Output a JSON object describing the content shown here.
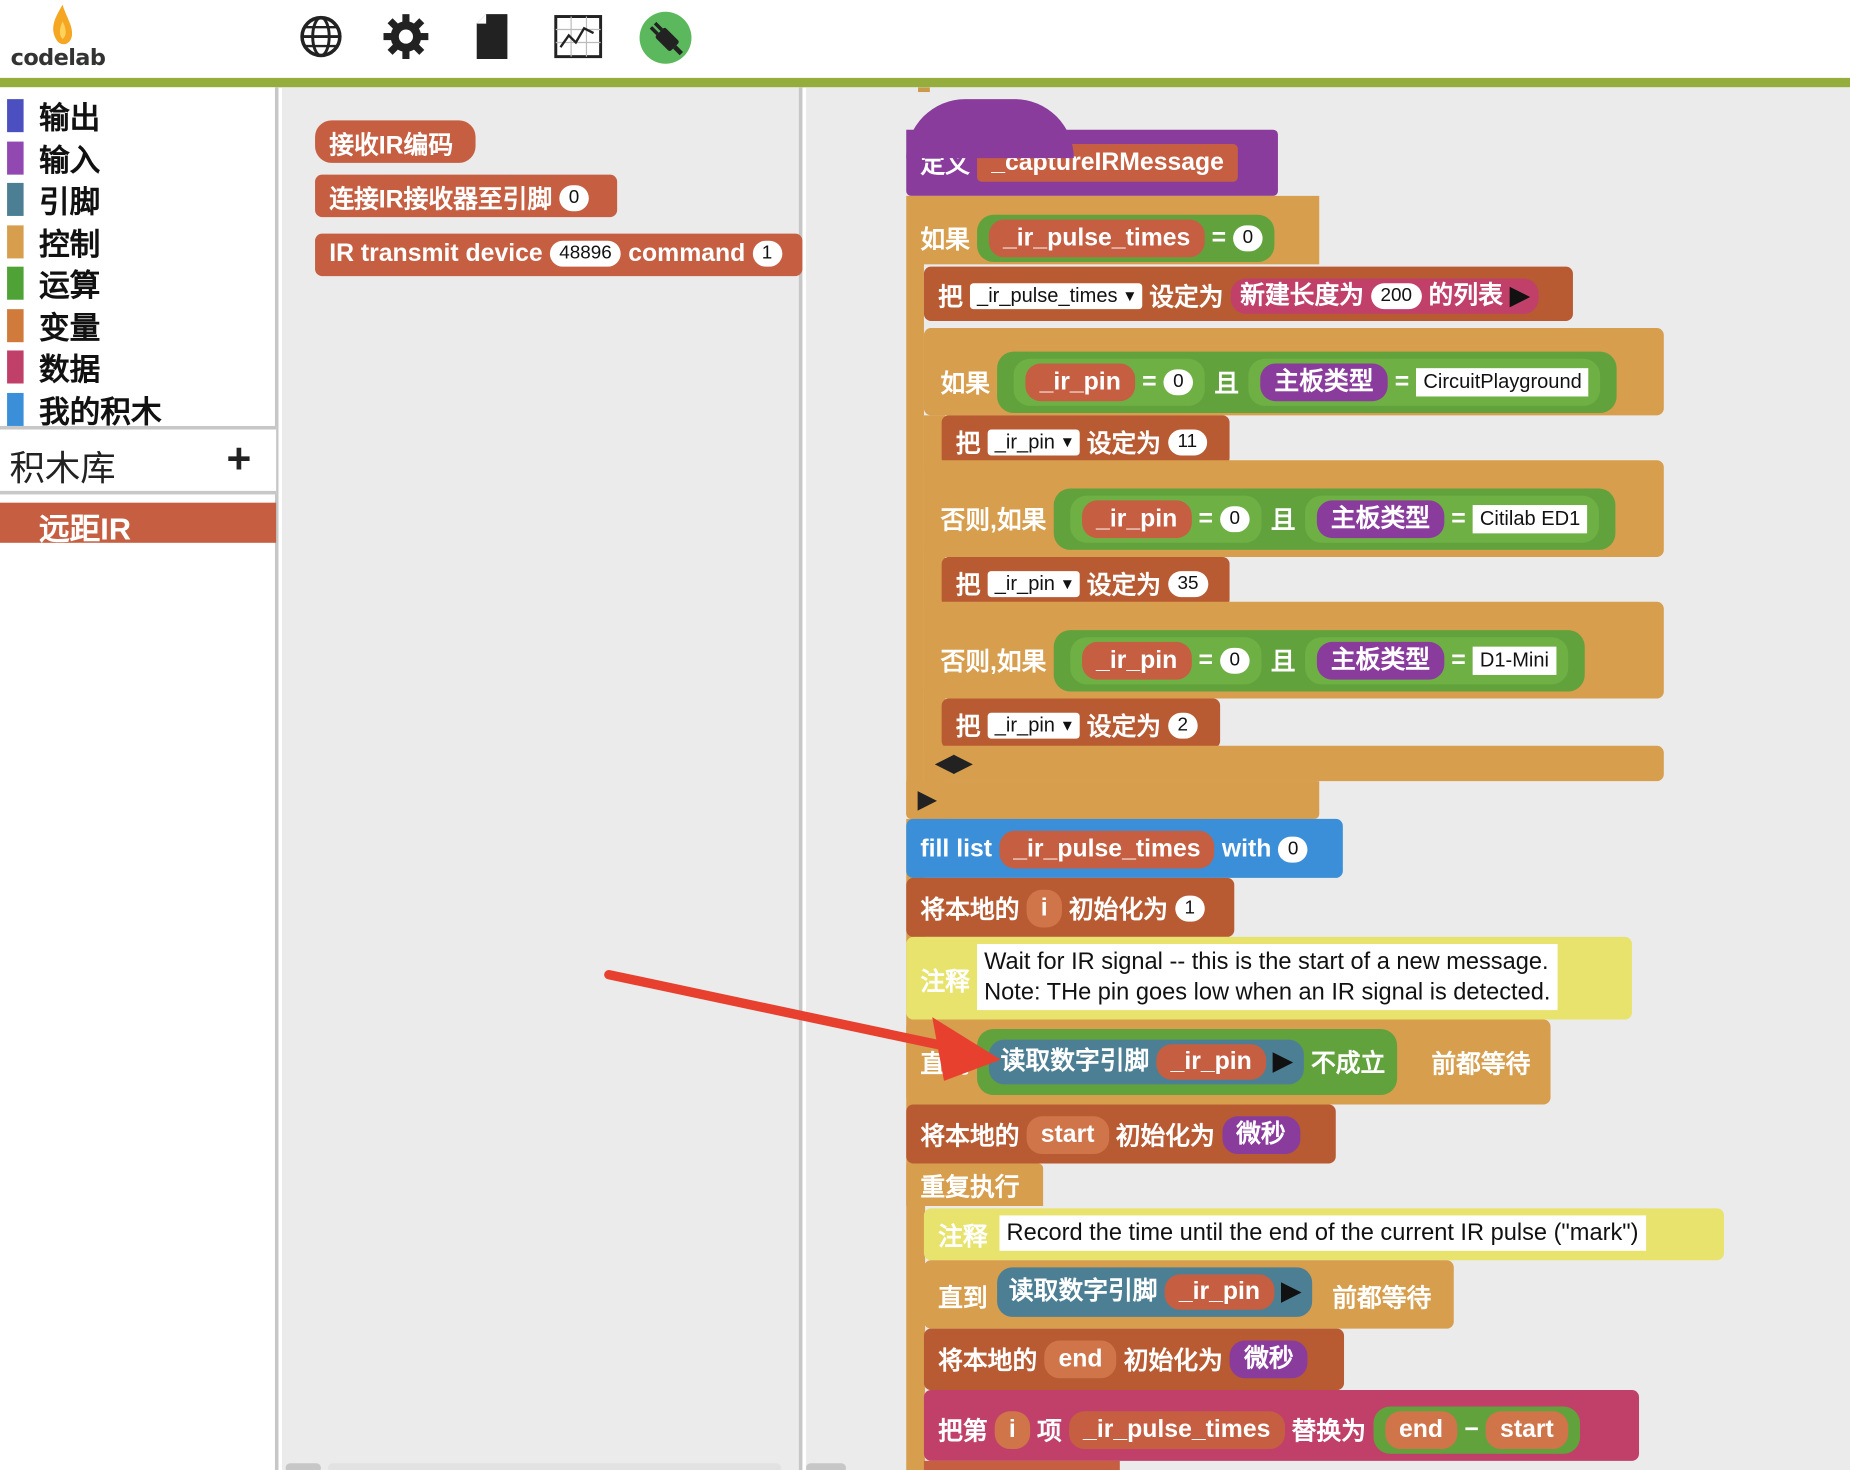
{
  "app": {
    "logo_text": "codelab"
  },
  "toolbar": {
    "icons": [
      "globe-icon",
      "gear-icon",
      "file-icon",
      "graph-icon",
      "usb-connection-icon"
    ]
  },
  "palette": {
    "categories": [
      {
        "label": "输出",
        "color": "#4b4fc0"
      },
      {
        "label": "输入",
        "color": "#9148b0"
      },
      {
        "label": "引脚",
        "color": "#4d7f94"
      },
      {
        "label": "控制",
        "color": "#d79e4d"
      },
      {
        "label": "运算",
        "color": "#4fa235"
      },
      {
        "label": "变量",
        "color": "#d07a3b"
      },
      {
        "label": "数据",
        "color": "#c0406a"
      },
      {
        "label": "我的积木",
        "color": "#3b8fd8"
      }
    ],
    "library_label": "积木库",
    "library_add": "+",
    "library_item": "远距IR"
  },
  "flyout": {
    "receive_ir": "接收IR编码",
    "attach_ir": {
      "text": "连接IR接收器至引脚",
      "pin": "0"
    },
    "ir_transmit": {
      "text1": "IR transmit device",
      "device": "48896",
      "text2": "command",
      "command": "1"
    }
  },
  "script": {
    "define": {
      "keyword": "定义",
      "name": "_captureIRMessage"
    },
    "if1": {
      "keyword": "如果",
      "var": "_ir_pulse_times",
      "op": "=",
      "value": "0"
    },
    "set_list": {
      "keyword": "把",
      "var": "_ir_pulse_times",
      "set_to": "设定为",
      "new_list": "新建长度为",
      "length": "200",
      "list_suffix": "的列表"
    },
    "if2": {
      "keyword": "如果",
      "var": "_ir_pin",
      "op": "=",
      "value": "0",
      "and": "且",
      "board_type": "主板类型",
      "board_value": "CircuitPlayground"
    },
    "set_pin_11": {
      "keyword": "把",
      "var": "_ir_pin",
      "set_to": "设定为",
      "value": "11"
    },
    "elseif1": {
      "keyword": "否则,如果",
      "var": "_ir_pin",
      "op": "=",
      "value": "0",
      "and": "且",
      "board_type": "主板类型",
      "board_value": "Citilab ED1"
    },
    "set_pin_35": {
      "keyword": "把",
      "var": "_ir_pin",
      "set_to": "设定为",
      "value": "35"
    },
    "elseif2": {
      "keyword": "否则,如果",
      "var": "_ir_pin",
      "op": "=",
      "value": "0",
      "and": "且",
      "board_type": "主板类型",
      "board_value": "D1-Mini"
    },
    "set_pin_2": {
      "keyword": "把",
      "var": "_ir_pin",
      "set_to": "设定为",
      "value": "2"
    },
    "fill_list": {
      "text1": "fill list",
      "var": "_ir_pulse_times",
      "text2": "with",
      "value": "0"
    },
    "local_i": {
      "text1": "将本地的",
      "var": "i",
      "text2": "初始化为",
      "value": "1"
    },
    "comment1": {
      "label": "注释",
      "line1": "Wait for IR signal -- this is the start of a new message.",
      "line2": "Note: THe pin goes low when an IR signal is detected."
    },
    "wait_until1": {
      "keyword": "直到",
      "read": "读取数字引脚",
      "var": "_ir_pin",
      "not": "不成立",
      "wait": "前都等待"
    },
    "local_start": {
      "text1": "将本地的",
      "var": "start",
      "text2": "初始化为",
      "value": "微秒"
    },
    "repeat": {
      "keyword": "重复执行"
    },
    "comment2": {
      "label": "注释",
      "text": "Record the time until the end of the current IR pulse (\"mark\")"
    },
    "wait_until2": {
      "keyword": "直到",
      "read": "读取数字引脚",
      "var": "_ir_pin",
      "wait": "前都等待"
    },
    "local_end": {
      "text1": "将本地的",
      "var": "end",
      "text2": "初始化为",
      "value": "微秒"
    },
    "replace_item": {
      "text1": "把第",
      "index": "i",
      "text2": "项",
      "var": "_ir_pulse_times",
      "text3": "替换为",
      "left": "end",
      "op": "−",
      "right": "start"
    }
  },
  "colors": {
    "topbar_line": "#94ad3c",
    "arrow": "#e8402f"
  }
}
